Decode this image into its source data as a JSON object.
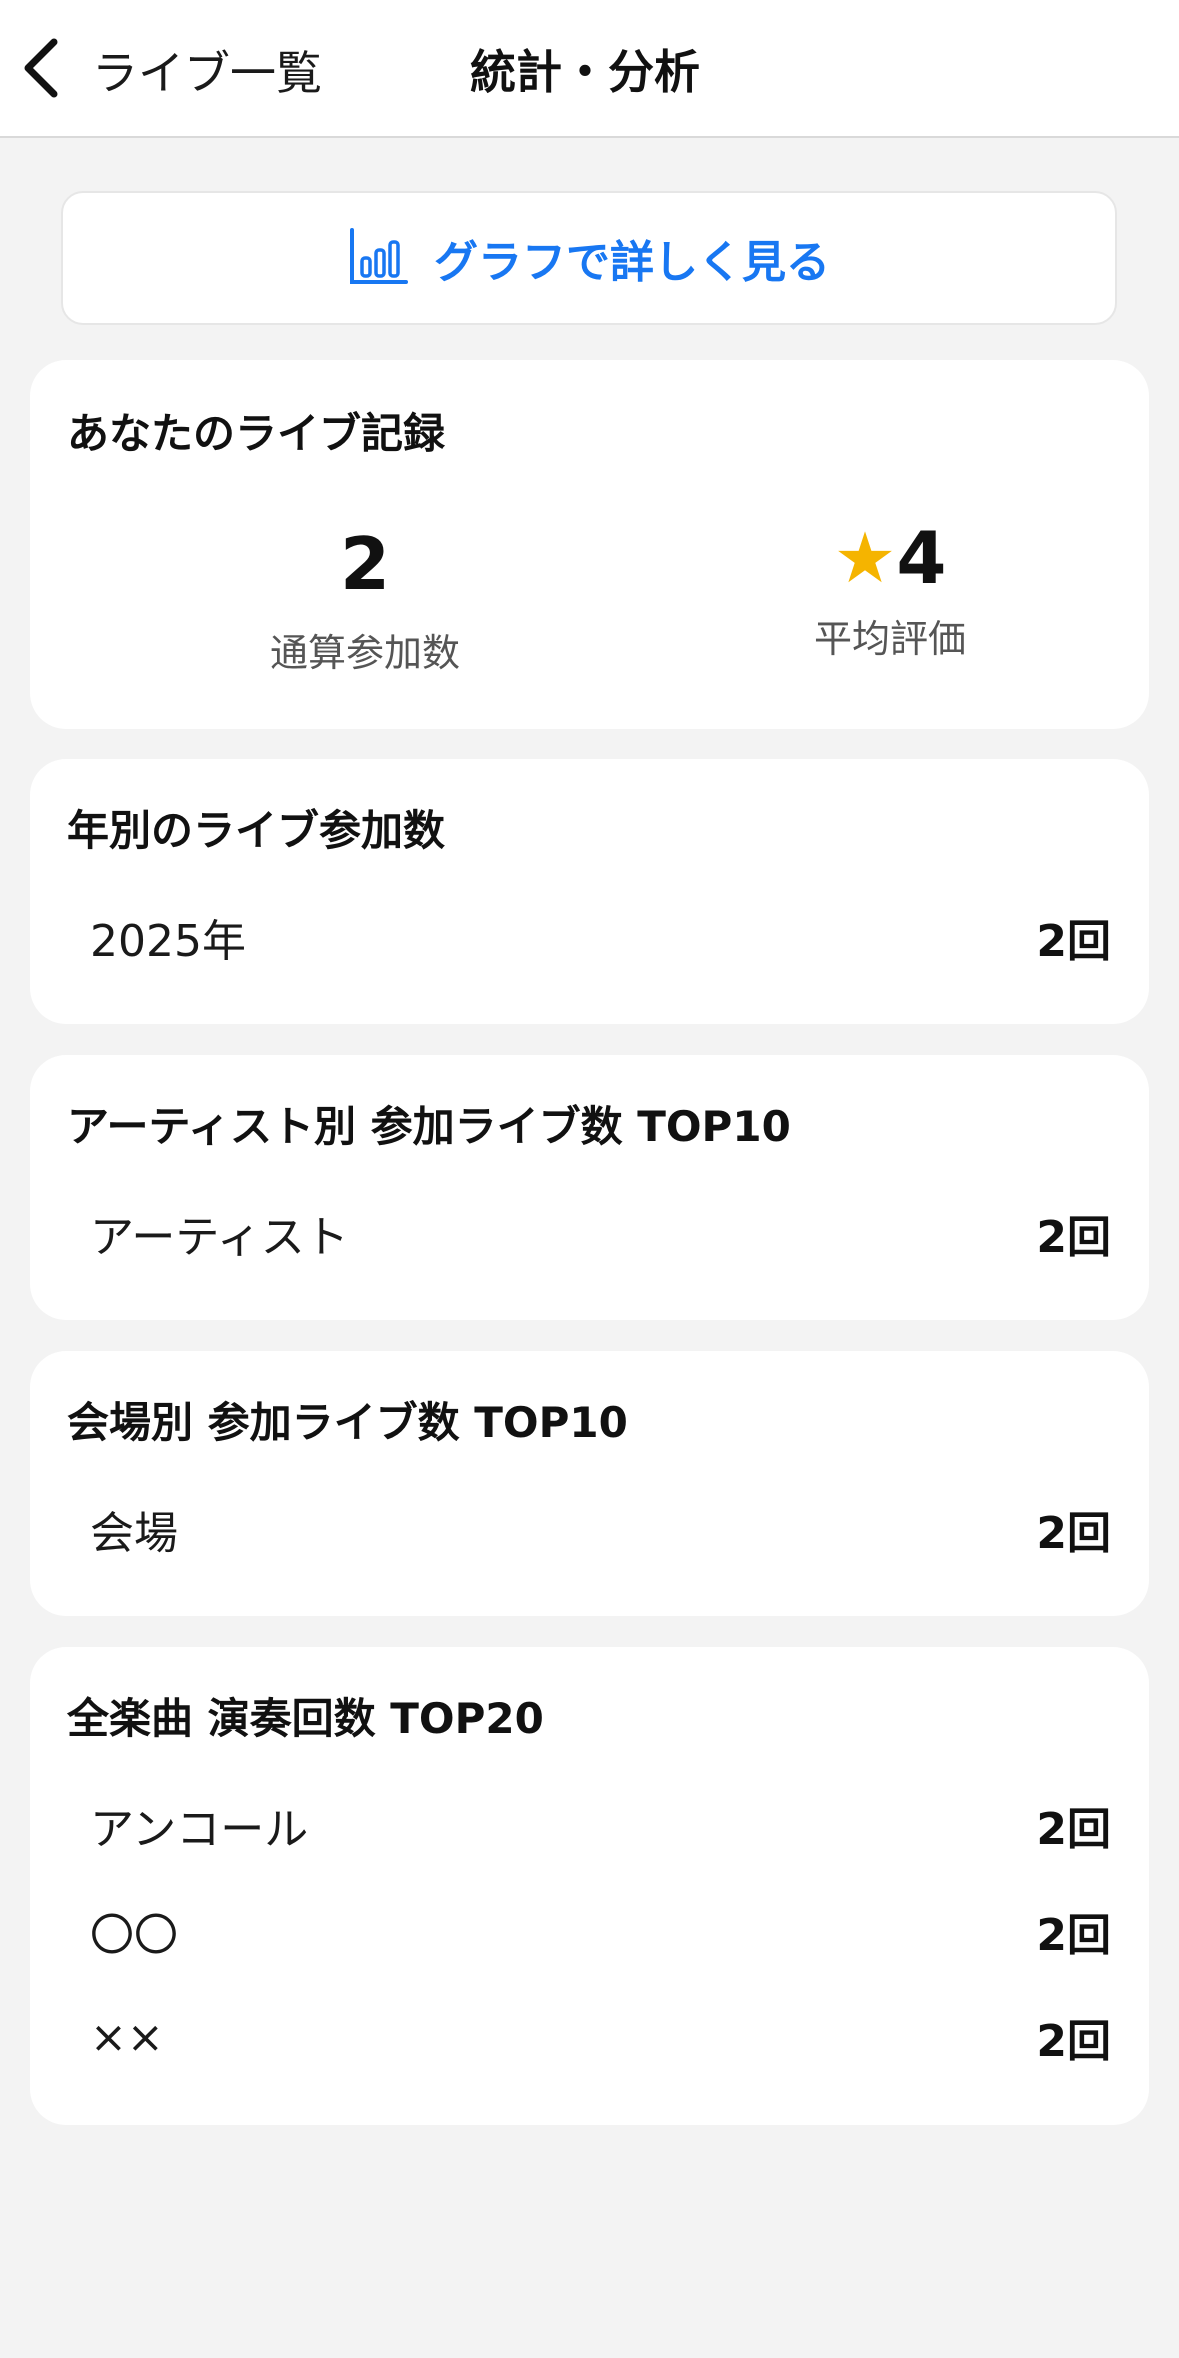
{
  "nav": {
    "back_label": "ライブ一覧",
    "title": "統計・分析"
  },
  "graph_button": {
    "label": "グラフで詳しく見る",
    "icon": "bar-chart-icon",
    "color": "#1877f2"
  },
  "summary": {
    "title": "あなたのライブ記録",
    "total": {
      "value": "2",
      "label": "通算参加数"
    },
    "rating": {
      "value": "4",
      "label": "平均評価",
      "icon": "star-icon",
      "star_color": "#f5b400"
    }
  },
  "yearly": {
    "title": "年別のライブ参加数",
    "rows": [
      {
        "label": "2025年",
        "value": "2回"
      }
    ]
  },
  "artists": {
    "title": "アーティスト別 参加ライブ数 TOP10",
    "rows": [
      {
        "label": "アーティスト",
        "value": "2回"
      }
    ]
  },
  "venues": {
    "title": "会場別 参加ライブ数 TOP10",
    "rows": [
      {
        "label": "会場",
        "value": "2回"
      }
    ]
  },
  "songs": {
    "title": "全楽曲 演奏回数 TOP20",
    "rows": [
      {
        "label": "アンコール",
        "value": "2回"
      },
      {
        "label": "〇〇",
        "value": "2回"
      },
      {
        "label": "××",
        "value": "2回"
      }
    ]
  }
}
